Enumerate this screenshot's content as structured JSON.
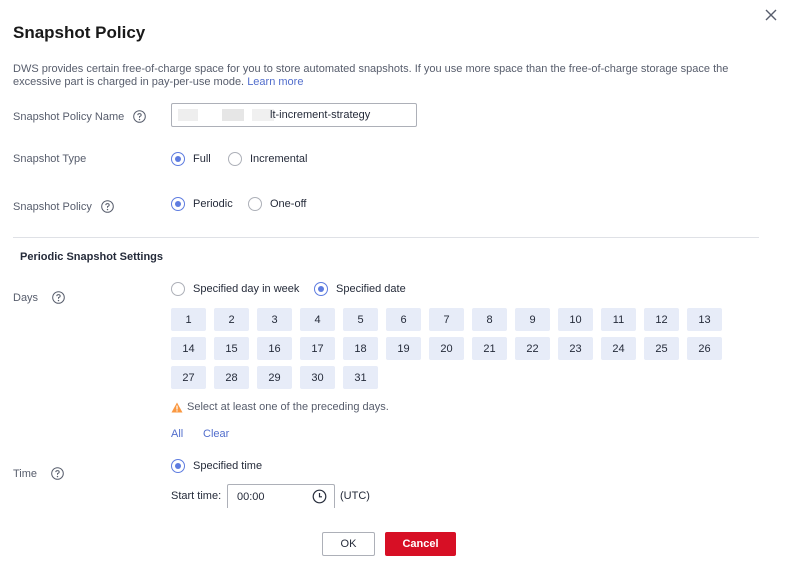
{
  "dialog": {
    "title": "Snapshot Policy",
    "description": "DWS provides certain free-of-charge space for you to store automated snapshots. If you use more space than the free-of-charge storage space the excessive part is charged in pay-per-use mode.",
    "learn_more": "Learn more"
  },
  "fields": {
    "name_label": "Snapshot Policy Name",
    "name_value": "lt-increment-strategy",
    "type_label": "Snapshot Type",
    "type_options": [
      "Full",
      "Incremental"
    ],
    "type_selected": "Full",
    "policy_label": "Snapshot Policy",
    "policy_options": [
      "Periodic",
      "One-off"
    ],
    "policy_selected": "Periodic"
  },
  "periodic": {
    "section_title": "Periodic Snapshot Settings",
    "days_label": "Days",
    "days_mode_options": [
      "Specified day in week",
      "Specified date"
    ],
    "days_mode_selected": "Specified date",
    "dates": [
      "1",
      "2",
      "3",
      "4",
      "5",
      "6",
      "7",
      "8",
      "9",
      "10",
      "11",
      "12",
      "13",
      "14",
      "15",
      "16",
      "17",
      "18",
      "19",
      "20",
      "21",
      "22",
      "23",
      "24",
      "25",
      "26",
      "27",
      "28",
      "29",
      "30",
      "31"
    ],
    "warning": "Select at least one of the preceding days.",
    "all_link": "All",
    "clear_link": "Clear",
    "time_label": "Time",
    "time_option": "Specified time",
    "start_time_label": "Start time:",
    "start_time_value": "00:00",
    "timezone": "(UTC)"
  },
  "footer": {
    "ok": "OK",
    "cancel": "Cancel"
  },
  "colors": {
    "accent": "#5e7ce0",
    "link": "#526ecc",
    "danger": "#d70f25",
    "warning": "#fa9841",
    "chip_bg": "#e7ecf8"
  },
  "icons": {
    "close": "close-icon",
    "help": "question-circle-icon",
    "warning": "warning-triangle-icon",
    "clock": "clock-icon"
  }
}
